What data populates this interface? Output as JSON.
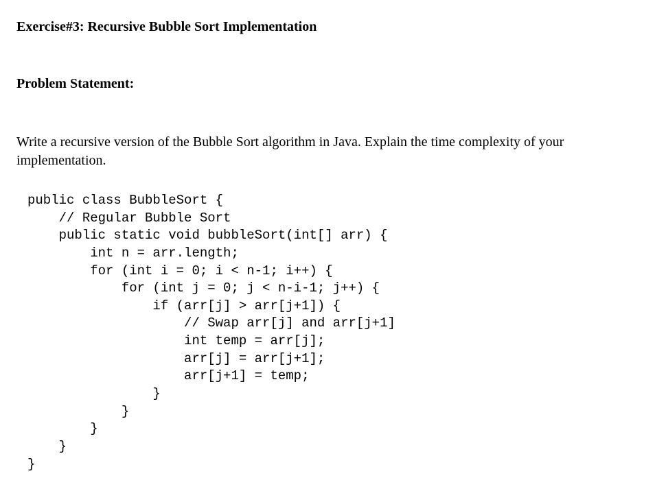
{
  "title": "Exercise#3: Recursive Bubble Sort Implementation",
  "subheading": "Problem Statement:",
  "problem_text": "Write a recursive version of the Bubble Sort algorithm in Java. Explain the time complexity of your implementation.",
  "code": "public class BubbleSort {\n    // Regular Bubble Sort\n    public static void bubbleSort(int[] arr) {\n        int n = arr.length;\n        for (int i = 0; i < n-1; i++) {\n            for (int j = 0; j < n-i-1; j++) {\n                if (arr[j] > arr[j+1]) {\n                    // Swap arr[j] and arr[j+1]\n                    int temp = arr[j];\n                    arr[j] = arr[j+1];\n                    arr[j+1] = temp;\n                }\n            }\n        }\n    }\n}"
}
